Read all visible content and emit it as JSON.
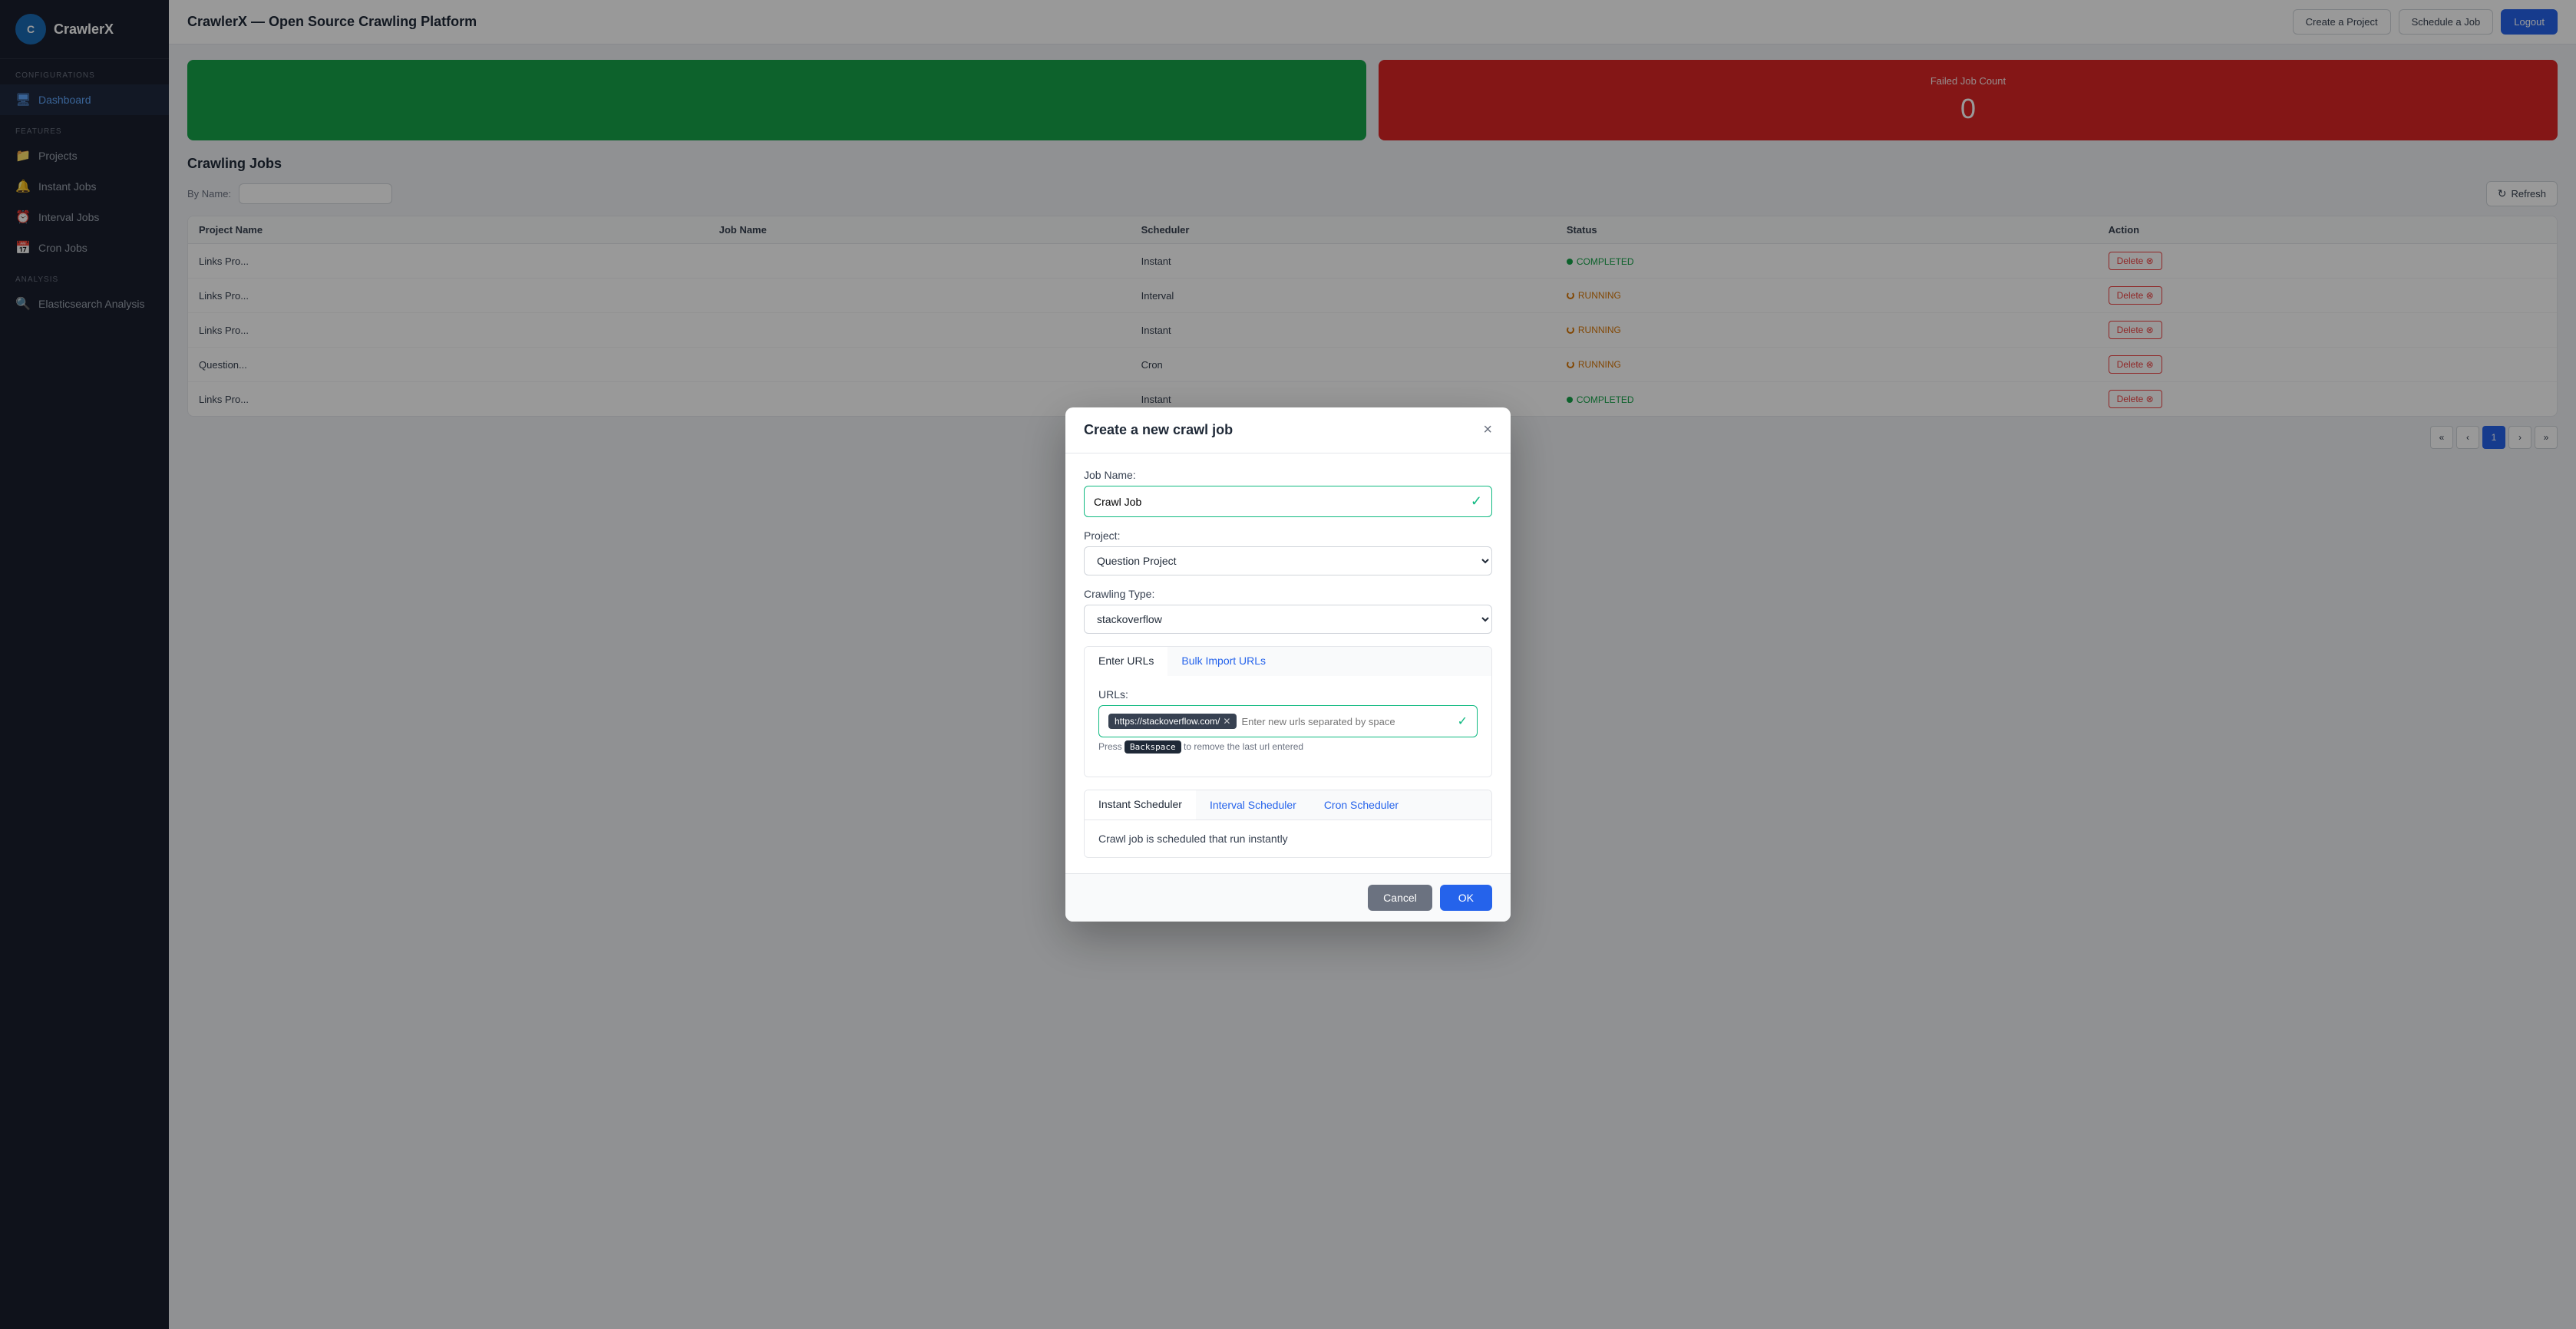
{
  "app": {
    "logo_text": "CrawlerX",
    "header_title": "CrawlerX — Open Source Crawling Platform"
  },
  "sidebar": {
    "configs_label": "CONFIGURATIONS",
    "features_label": "FEATURES",
    "analysis_label": "ANALYSIS",
    "items": [
      {
        "id": "dashboard",
        "label": "Dashboard",
        "icon": "🖥",
        "active": true
      },
      {
        "id": "projects",
        "label": "Projects",
        "icon": "📁",
        "active": false
      },
      {
        "id": "instant-jobs",
        "label": "Instant Jobs",
        "icon": "🔔",
        "active": false
      },
      {
        "id": "interval-jobs",
        "label": "Interval Jobs",
        "icon": "⏰",
        "active": false
      },
      {
        "id": "cron-jobs",
        "label": "Cron Jobs",
        "icon": "📅",
        "active": false
      },
      {
        "id": "elasticsearch",
        "label": "Elasticsearch Analysis",
        "icon": "🔍",
        "active": false
      }
    ]
  },
  "header": {
    "title": "CrawlerX — Open Source Crawling Platform",
    "buttons": {
      "create_project": "Create a Project",
      "schedule_job": "Schedule a Job",
      "logout": "Logout"
    }
  },
  "stats": [
    {
      "id": "green-card",
      "label": "...",
      "value": "",
      "color": "green"
    },
    {
      "id": "failed-job-count",
      "label": "Failed Job Count",
      "value": "0",
      "color": "red"
    }
  ],
  "crawling_jobs": {
    "section_title": "Crawling Jobs",
    "filter_label": "By Name:",
    "refresh_label": "Refresh",
    "table": {
      "columns": [
        "Project Name",
        "Job Name",
        "Scheduler",
        "Status",
        "Action"
      ],
      "rows": [
        {
          "project": "Links Pro...",
          "job": "",
          "scheduler": "Instant",
          "status": "COMPLETED",
          "status_type": "completed"
        },
        {
          "project": "Links Pro...",
          "job": "",
          "scheduler": "Interval",
          "status": "RUNNING",
          "status_type": "running"
        },
        {
          "project": "Links Pro...",
          "job": "",
          "scheduler": "Instant",
          "status": "RUNNING",
          "status_type": "running"
        },
        {
          "project": "Question...",
          "job": "",
          "scheduler": "Cron",
          "status": "RUNNING",
          "status_type": "running"
        },
        {
          "project": "Links Pro...",
          "job": "",
          "scheduler": "Instant",
          "status": "COMPLETED",
          "status_type": "completed"
        }
      ]
    },
    "pagination": {
      "first": "«",
      "prev": "‹",
      "page": "1",
      "next": "›",
      "last": "»"
    }
  },
  "modal": {
    "title": "Create a new crawl job",
    "close_label": "×",
    "job_name_label": "Job Name:",
    "job_name_value": "Crawl Job",
    "project_label": "Project:",
    "project_value": "Question Project",
    "crawling_type_label": "Crawling Type:",
    "crawling_type_value": "stackoverflow",
    "tabs": {
      "enter_urls": "Enter URLs",
      "bulk_import": "Bulk Import URLs"
    },
    "urls_label": "URLs:",
    "url_tag": "https://stackoverflow.com/",
    "url_placeholder": "Enter new urls separated by space",
    "url_hint_prefix": "Press",
    "url_hint_key": "Backspace",
    "url_hint_suffix": "to remove the last url entered",
    "scheduler_tabs": {
      "instant": "Instant Scheduler",
      "interval": "Interval Scheduler",
      "cron": "Cron Scheduler"
    },
    "instant_description": "Crawl job is scheduled that run instantly",
    "cancel_label": "Cancel",
    "ok_label": "OK"
  }
}
